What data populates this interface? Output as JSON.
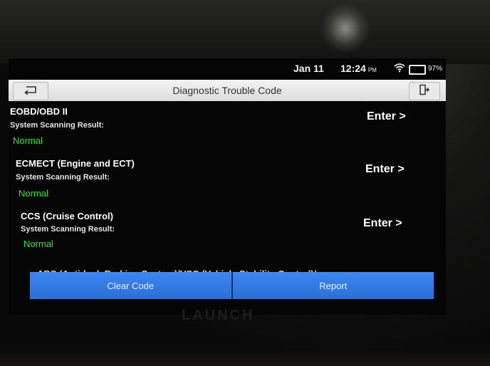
{
  "status_bar": {
    "date": "Jan 11",
    "time": "12:24",
    "ampm": "PM",
    "battery": "97%"
  },
  "header": {
    "title": "Diagnostic Trouble Code"
  },
  "systems": [
    {
      "name": "EOBD/OBD II",
      "label": "System Scanning Result:",
      "result": "Normal",
      "action": "Enter >"
    },
    {
      "name": "ECMECT (Engine and ECT)",
      "label": "System Scanning Result:",
      "result": "Normal",
      "action": "Enter >"
    },
    {
      "name": "CCS (Cruise Control)",
      "label": "System Scanning Result:",
      "result": "Normal",
      "action": "Enter >"
    }
  ],
  "partial_item": "ABS (Anti-lock Braking System)/VSC (Vehicle Stability Control)/",
  "footer": {
    "clear_code": "Clear Code",
    "report": "Report"
  },
  "device_logo": "LAUNCH",
  "colors": {
    "result_green": "#2ee62e",
    "button_blue": "#2b6fd8"
  }
}
